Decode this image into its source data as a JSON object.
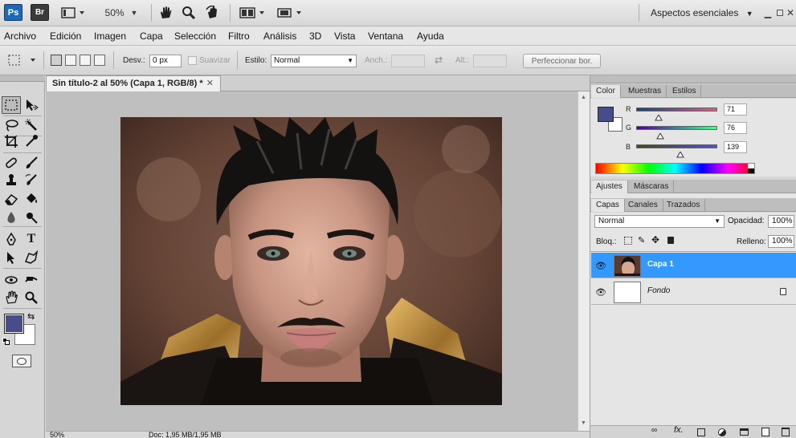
{
  "appbar": {
    "logo_ps": "Ps",
    "logo_br": "Br",
    "zoom": "50%",
    "workspace": "Aspectos esenciales",
    "icons": [
      "screen-mode-icon",
      "hand-icon",
      "zoom-icon",
      "rotate-view-icon",
      "arrange-docs-icon",
      "screen-mode-icon",
      "minimize-icon",
      "restore-icon",
      "close-icon"
    ]
  },
  "menu": [
    "Archivo",
    "Edición",
    "Imagen",
    "Capa",
    "Selección",
    "Filtro",
    "Análisis",
    "3D",
    "Vista",
    "Ventana",
    "Ayuda"
  ],
  "options": {
    "desv_label": "Desv.:",
    "desv_value": "0 px",
    "suavizar_label": "Suavizar",
    "estilo_label": "Estilo:",
    "estilo_value": "Normal",
    "anch_label": "Anch.:",
    "alt_label": "Alt.:",
    "refine_button": "Perfeccionar bor."
  },
  "tools": [
    "marquee-icon",
    "move-icon",
    "lasso-icon",
    "quick-selection-icon",
    "crop-icon",
    "eyedropper-icon",
    "healing-brush-icon",
    "brush-icon",
    "clone-stamp-icon",
    "history-brush-icon",
    "eraser-icon",
    "paint-bucket-icon",
    "blur-icon",
    "dodge-icon",
    "pen-icon",
    "type-icon",
    "path-selection-icon",
    "shape-icon",
    "3d-rotate-icon",
    "3d-orbit-icon",
    "hand-icon",
    "zoom-icon"
  ],
  "colors": {
    "foreground": "#474c8b",
    "background": "#ffffff",
    "accent": "#3399ff"
  },
  "document": {
    "tab_title": "Sin título-2 al 50% (Capa 1, RGB/8) *",
    "status_zoom": "50%",
    "status_doc": "Doc: 1,95 MB/1,95 MB"
  },
  "color_panel": {
    "tabs": [
      "Color",
      "Muestras",
      "Estilos"
    ],
    "r_label": "R",
    "r_value": 71,
    "g_label": "G",
    "g_value": 76,
    "b_label": "B",
    "b_value": 139
  },
  "adjust_panel": {
    "tabs": [
      "Ajustes",
      "Máscaras"
    ]
  },
  "layers_panel": {
    "tabs": [
      "Capas",
      "Canales",
      "Trazados"
    ],
    "blend_mode": "Normal",
    "opacity_label": "Opacidad:",
    "opacity_value": "100%",
    "lock_label": "Bloq.:",
    "fill_label": "Relleno:",
    "fill_value": "100%",
    "layers": [
      {
        "name": "Capa 1",
        "selected": true
      },
      {
        "name": "Fondo",
        "selected": false
      }
    ]
  }
}
